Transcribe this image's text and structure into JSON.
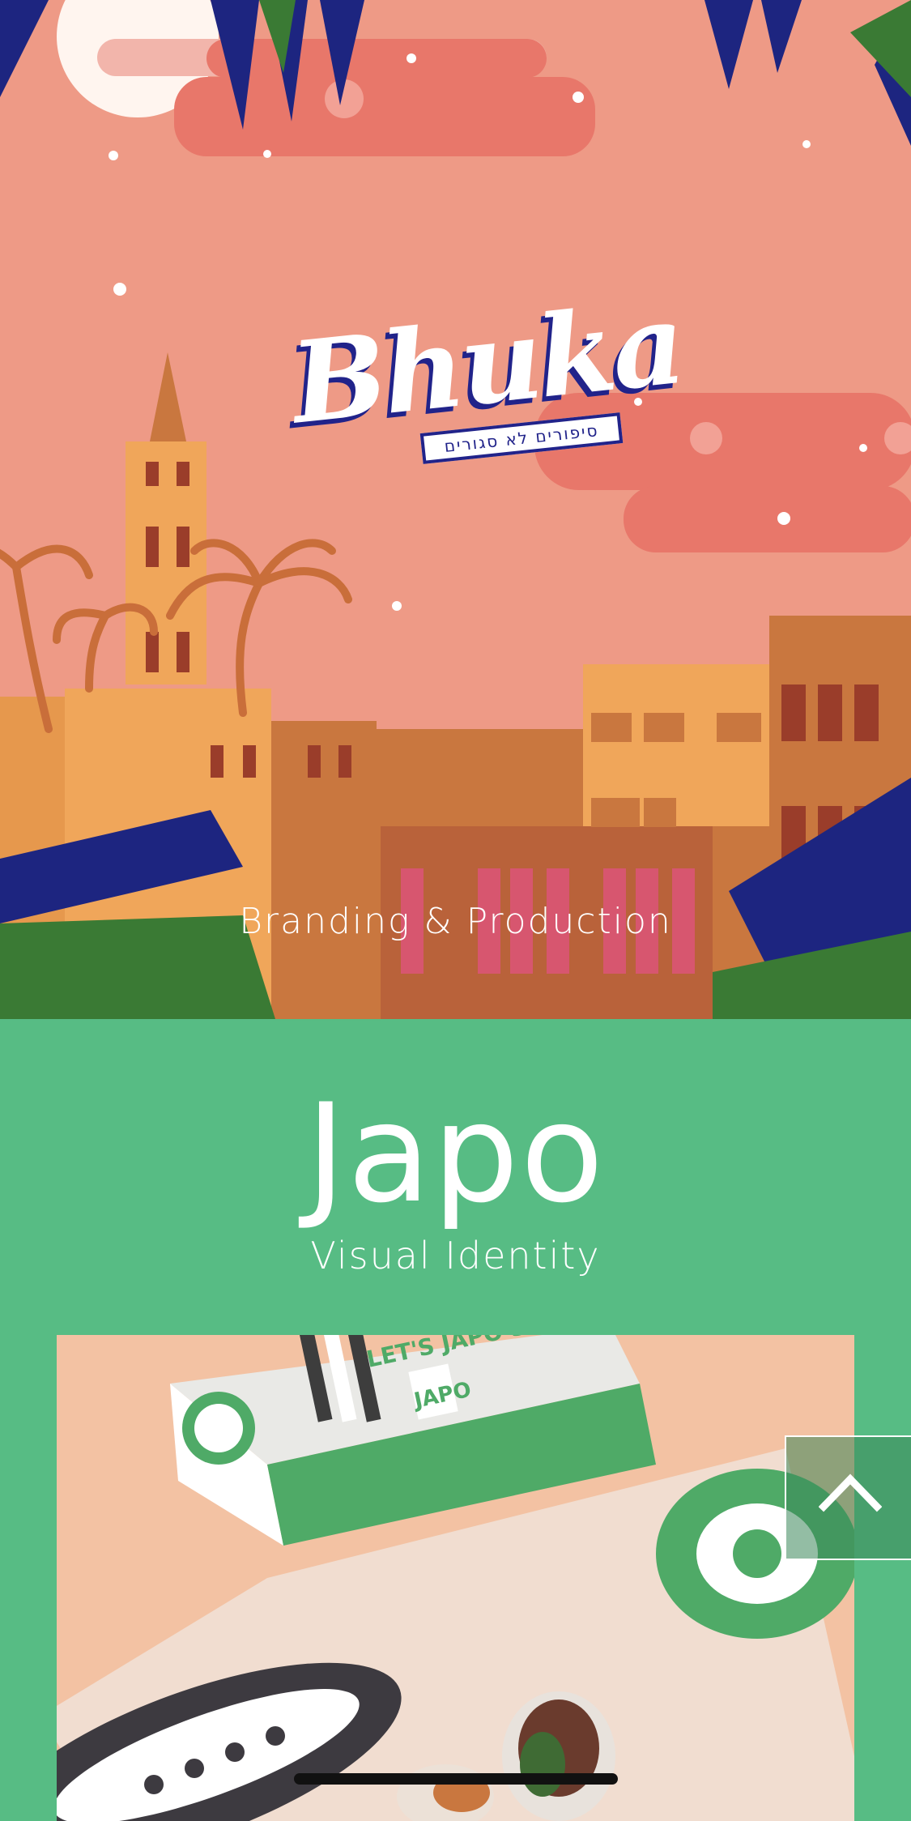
{
  "hero": {
    "logo_text": "Bhuka",
    "logo_tagline": "סיפורים לא סגורים",
    "caption": "Branding & Production"
  },
  "project": {
    "title": "Japo",
    "subtitle": "Visual Identity",
    "package_text": "JAPO",
    "package_slogan": "LET'S JAPO STYLE"
  },
  "controls": {
    "scroll_top_icon": "chevron-up-icon"
  },
  "colors": {
    "hero_sky": "#ee9a86",
    "brand_green": "#57bc84",
    "navy": "#21238a",
    "building_orange": "#f0a65a"
  }
}
